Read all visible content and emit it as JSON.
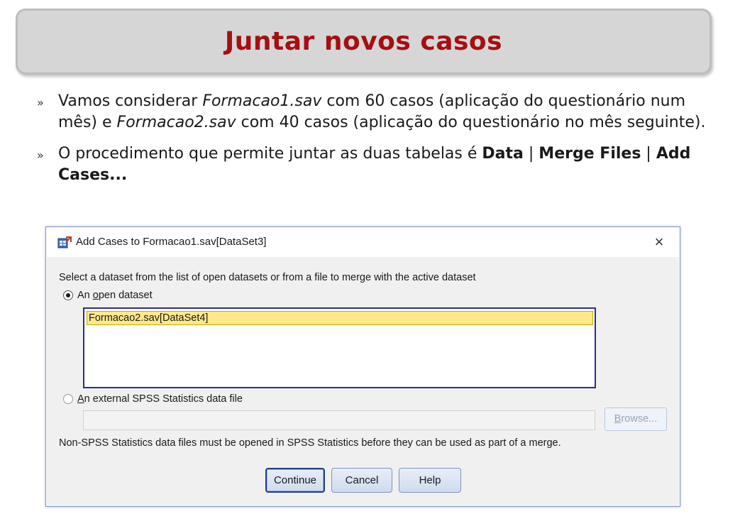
{
  "slide": {
    "title": "Juntar novos casos",
    "bullet_mark": "»",
    "bullet1": {
      "p1": "Vamos considerar ",
      "file1": "Formacao1.sav",
      "p2": " com 60 casos (aplicação do questionário num mês) e ",
      "file2": "Formacao2.sav",
      "p3": " com 40 casos (aplicação do questionário no mês seguinte)."
    },
    "bullet2": {
      "p1": "O procedimento que permite juntar as duas tabelas é ",
      "m1": "Data",
      "sep1": " | ",
      "m2": "Merge Files",
      "sep2": " | ",
      "m3": "Add Cases..."
    }
  },
  "dialog": {
    "title": "Add Cases to Formacao1.sav[DataSet3]",
    "close_glyph": "×",
    "instruction": "Select a dataset from the list of open datasets or from a file to merge with the active dataset",
    "radio_open": {
      "pre": "An ",
      "accel": "o",
      "post": "pen dataset"
    },
    "open_datasets": [
      "Formacao2.sav[DataSet4]"
    ],
    "radio_external": {
      "accel": "A",
      "post": "n external SPSS Statistics data file"
    },
    "file_path": "",
    "browse_label": {
      "accel": "B",
      "post": "rowse..."
    },
    "note": "Non-SPSS Statistics data files must be opened in SPSS Statistics before they can be used as part of a merge.",
    "buttons": {
      "continue": "Continue",
      "cancel": "Cancel",
      "help": "Help"
    }
  },
  "colors": {
    "title_red": "#a50f12",
    "list_selection": "#fde98a",
    "listbox_border": "#2a2f8a"
  }
}
